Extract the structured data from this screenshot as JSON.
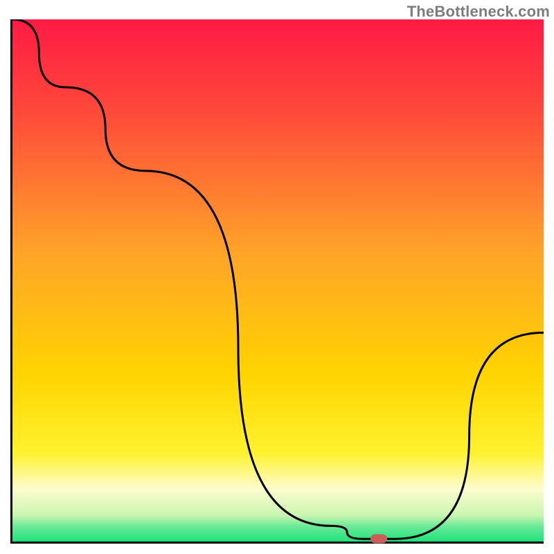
{
  "watermark": "TheBottleneck.com",
  "chart_data": {
    "type": "line",
    "title": "",
    "xlabel": "",
    "ylabel": "",
    "xlim": [
      0,
      100
    ],
    "ylim": [
      0,
      100
    ],
    "grid": false,
    "legend": false,
    "series": [
      {
        "name": "curve",
        "color": "#000000",
        "x": [
          0,
          10,
          25,
          60,
          66,
          72,
          100
        ],
        "y": [
          100,
          87,
          71,
          3,
          0.5,
          0.5,
          40
        ]
      }
    ],
    "marker": {
      "x": 69,
      "y": 0.5,
      "color": "#cd5c5c"
    },
    "background_gradient": {
      "type": "bottleneck",
      "top_color": "#ff1a44",
      "mid_color": "#ffd400",
      "green_band_color": "#1ee27a",
      "pale_band_color": "#fdfccf"
    }
  },
  "layout": {
    "plot_inner_w": 767,
    "plot_inner_h": 754
  }
}
